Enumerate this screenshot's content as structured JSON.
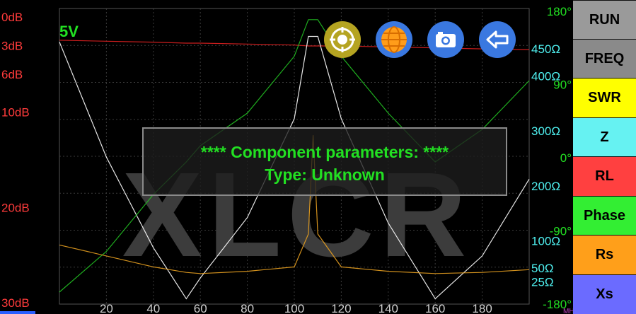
{
  "app": {
    "watermark": "XLCR",
    "voltage_label": "5V"
  },
  "colors": {
    "db": "#ff3b3b",
    "ohm": "#4ff0f0",
    "phase": "#22e022",
    "grid": "#3a3a3a",
    "freq": "#cfcfcf"
  },
  "left_axis": {
    "labels": [
      {
        "text": "0dB",
        "y": 0
      },
      {
        "text": "3dB",
        "y": 3
      },
      {
        "text": "6dB",
        "y": 6
      },
      {
        "text": "10dB",
        "y": 10
      },
      {
        "text": "20dB",
        "y": 20
      },
      {
        "text": "30dB",
        "y": 30
      }
    ]
  },
  "right_axis": {
    "phase_labels": [
      {
        "text": "180°",
        "deg": 180
      },
      {
        "text": "90°",
        "deg": 90
      },
      {
        "text": "0°",
        "deg": 0
      },
      {
        "text": "-90°",
        "deg": -90
      },
      {
        "text": "-180°",
        "deg": -180
      }
    ],
    "ohm_labels": [
      {
        "text": "450Ω",
        "ohm": 450
      },
      {
        "text": "400Ω",
        "ohm": 400
      },
      {
        "text": "300Ω",
        "ohm": 300
      },
      {
        "text": "200Ω",
        "ohm": 200
      },
      {
        "text": "100Ω",
        "ohm": 100
      },
      {
        "text": "50Ω",
        "ohm": 50
      },
      {
        "text": "25Ω",
        "ohm": 25
      }
    ]
  },
  "x_axis": {
    "ticks": [
      "20",
      "40",
      "60",
      "80",
      "100",
      "120",
      "140",
      "160",
      "180"
    ],
    "range": [
      0,
      200
    ],
    "unit": "MHz"
  },
  "toolbar_icons": [
    {
      "name": "target-icon",
      "color": "#b5a421"
    },
    {
      "name": "globe-icon",
      "color": "#3a78e0"
    },
    {
      "name": "camera-icon",
      "color": "#3a78e0"
    },
    {
      "name": "back-arrow-icon",
      "color": "#3a78e0"
    }
  ],
  "side_buttons": [
    {
      "label": "RUN",
      "bg": "#9a9a9a"
    },
    {
      "label": "FREQ",
      "bg": "#8a8a8a"
    },
    {
      "label": "SWR",
      "bg": "#ffff00"
    },
    {
      "label": "Z",
      "bg": "#66f2f2"
    },
    {
      "label": "RL",
      "bg": "#ff4040"
    },
    {
      "label": "Phase",
      "bg": "#33ee33"
    },
    {
      "label": "Rs",
      "bg": "#ff9f1a"
    },
    {
      "label": "Xs",
      "bg": "#6b6bff"
    }
  ],
  "dialog": {
    "line1": "**** Component parameters: ****",
    "line2": "Type: Unknown"
  },
  "chart_data": {
    "type": "line",
    "x": [
      0,
      20,
      40,
      54,
      60,
      80,
      100,
      106,
      108,
      110,
      120,
      140,
      160,
      180,
      200
    ],
    "series": [
      {
        "values": [
          2,
          2.1,
          2.2,
          2.3,
          2.3,
          2.4,
          2.5,
          2.6,
          2.6,
          2.6,
          2.6,
          2.7,
          2.8,
          2.9,
          3
        ]
      },
      {
        "values": [
          470,
          260,
          95,
          2,
          40,
          150,
          330,
          480,
          480,
          480,
          330,
          140,
          2,
          80,
          220
        ]
      },
      {
        "values": [
          -160,
          -110,
          -40,
          0,
          20,
          60,
          130,
          175,
          175,
          175,
          130,
          60,
          0,
          40,
          100
        ]
      },
      {
        "values": [
          100,
          80,
          60,
          50,
          48,
          52,
          60,
          120,
          300,
          120,
          60,
          52,
          48,
          50,
          55
        ]
      }
    ]
  }
}
